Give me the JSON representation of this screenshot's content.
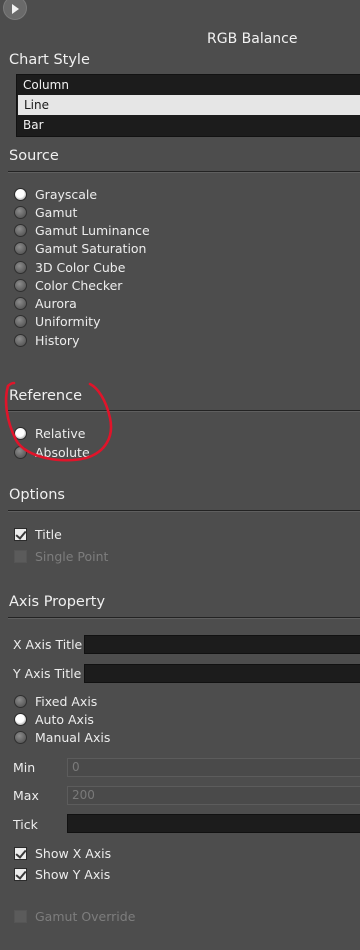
{
  "header": {
    "title": "RGB Balance"
  },
  "chart_style": {
    "title": "Chart Style",
    "items": [
      "Column",
      "Line",
      "Bar"
    ],
    "selected": "Line"
  },
  "source": {
    "title": "Source",
    "options": [
      "Grayscale",
      "Gamut",
      "Gamut Luminance",
      "Gamut Saturation",
      "3D Color Cube",
      "Color Checker",
      "Aurora",
      "Uniformity",
      "History"
    ],
    "selected": "Grayscale"
  },
  "reference": {
    "title": "Reference",
    "options": [
      "Relative",
      "Absolute"
    ],
    "selected": "Relative"
  },
  "options": {
    "title": "Options",
    "title_checkbox": "Title",
    "single_point": "Single Point"
  },
  "axis_property": {
    "title": "Axis Property",
    "x_axis_title_label": "X Axis Title",
    "x_axis_title_value": "",
    "y_axis_title_label": "Y Axis Title",
    "y_axis_title_value": "",
    "axis_modes": [
      "Fixed Axis",
      "Auto Axis",
      "Manual Axis"
    ],
    "axis_mode_selected": "Auto Axis",
    "min_label": "Min",
    "min_value": "0",
    "max_label": "Max",
    "max_value": "200",
    "tick_label": "Tick",
    "tick_value": "",
    "show_x_axis": "Show X Axis",
    "show_y_axis": "Show Y Axis",
    "gamut_override": "Gamut Override"
  },
  "colors": {
    "panel_bg": "#4d4d4d",
    "annotation": "#e0142a"
  }
}
